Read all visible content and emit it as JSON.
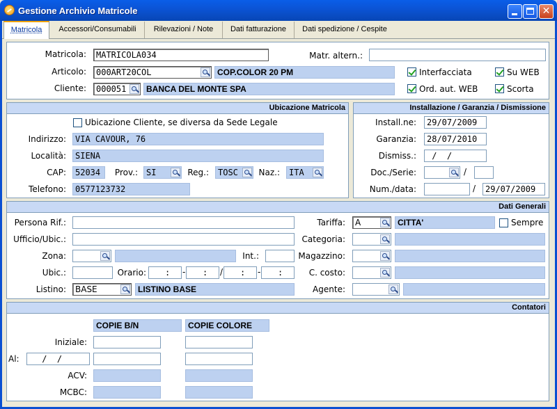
{
  "window": {
    "title": "Gestione Archivio Matricole",
    "icon": "app-icon"
  },
  "tabs": [
    {
      "label": "Matricola",
      "active": true
    },
    {
      "label": "Accessori/Consumabili"
    },
    {
      "label": "Rilevazioni / Note"
    },
    {
      "label": "Dati fatturazione"
    },
    {
      "label": "Dati spedizione / Cespite"
    }
  ],
  "header": {
    "matricola_label": "Matricola:",
    "matricola_value": "MATRICOLA034",
    "matr_altern_label": "Matr. altern.:",
    "matr_altern_value": "",
    "articolo_label": "Articolo:",
    "articolo_code": "000ART20COL",
    "articolo_desc": "COP.COLOR 20 PM",
    "cliente_label": "Cliente:",
    "cliente_code": "000051",
    "cliente_desc": "BANCA DEL MONTE SPA",
    "checks": {
      "interfacciata": {
        "label": "Interfacciata",
        "checked": true
      },
      "su_web": {
        "label": "Su WEB",
        "checked": true
      },
      "ord_aut_web": {
        "label": "Ord. aut. WEB",
        "checked": true
      },
      "scorta": {
        "label": "Scorta",
        "checked": true
      }
    }
  },
  "ubicazione": {
    "title": "Ubicazione Matricola",
    "check_label": "Ubicazione Cliente, se diversa da Sede Legale",
    "check_checked": false,
    "indirizzo_label": "Indirizzo:",
    "indirizzo": "VIA CAVOUR, 76",
    "localita_label": "Località:",
    "localita": "SIENA",
    "cap_label": "CAP:",
    "cap": "52034",
    "prov_label": "Prov.:",
    "prov": "SI",
    "reg_label": "Reg.:",
    "reg": "TOSC",
    "naz_label": "Naz.:",
    "naz": "ITA",
    "telefono_label": "Telefono:",
    "telefono": "0577123732"
  },
  "installazione": {
    "title": "Installazione / Garanzia / Dismissione",
    "install_label": "Install.ne:",
    "install": "29/07/2009",
    "garanzia_label": "Garanzia:",
    "garanzia": "28/07/2010",
    "dismiss_label": "Dismiss.:",
    "dismiss": " /  /",
    "doc_serie_label": "Doc./Serie:",
    "doc": "",
    "serie": "",
    "slash": "/",
    "num_data_label": "Num./data:",
    "num": "",
    "data": "29/07/2009"
  },
  "dati_generali": {
    "title": "Dati Generali",
    "persona_label": "Persona Rif.:",
    "persona": "",
    "ufficio_label": "Ufficio/Ubic.:",
    "ufficio": "",
    "zona_label": "Zona:",
    "zona": "",
    "zona_desc": "",
    "int_label": "Int.:",
    "int": "",
    "ubic_label": "Ubic.:",
    "ubic": "",
    "orario_label": "Orario:",
    "orario": [
      " :",
      " :",
      " :",
      " :"
    ],
    "orario_slash": "/",
    "orario_dash": "-",
    "listino_label": "Listino:",
    "listino_code": "BASE",
    "listino_desc": "LISTINO BASE",
    "tariffa_label": "Tariffa:",
    "tariffa_code": "A",
    "tariffa_desc": "CITTA'",
    "sempre_label": "Sempre",
    "sempre_checked": false,
    "categoria_label": "Categoria:",
    "magazzino_label": "Magazzino:",
    "ccosto_label": "C. costo:",
    "agente_label": "Agente:"
  },
  "contatori": {
    "title": "Contatori",
    "col_bn": "COPIE B/N",
    "col_colore": "COPIE COLORE",
    "iniziale_label": "Iniziale:",
    "al_label": "Al:",
    "al_date": " /  /",
    "acv_label": "ACV:",
    "mcbc_label": "MCBC:"
  },
  "colors": {
    "accent": "#0a5ee8",
    "readonly": "#bdd1f0",
    "panel_head": "#c8d9f5",
    "dialog_bg": "#ece9d8"
  }
}
